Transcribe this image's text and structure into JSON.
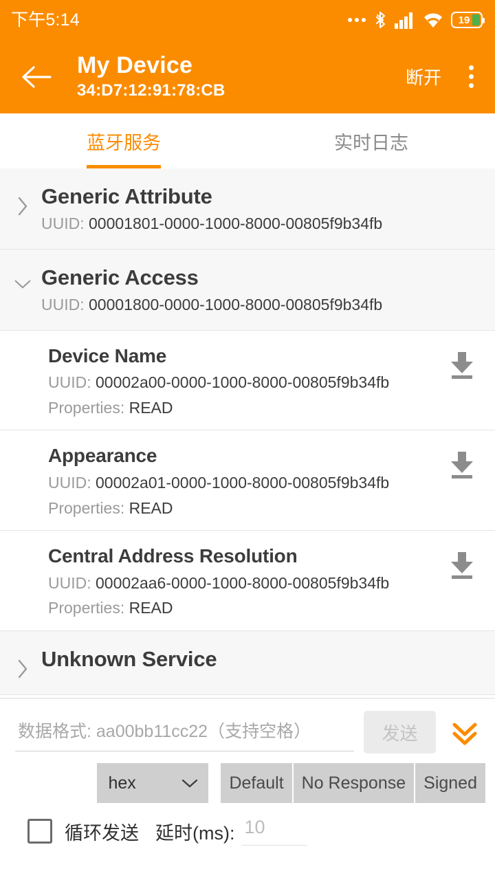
{
  "status_bar": {
    "time": "下午5:14",
    "icons": [
      "more-dots-icon",
      "bluetooth-icon",
      "cellular-signal-icon",
      "wifi-icon",
      "battery-icon"
    ],
    "battery_level": "19"
  },
  "app_bar": {
    "back_icon": "back-arrow-icon",
    "title": "My Device",
    "subtitle": "34:D7:12:91:78:CB",
    "action_label": "断开",
    "overflow_icon": "overflow-menu-icon",
    "background_color": "#fb8c00"
  },
  "tabs": {
    "active_index": 0,
    "items": [
      {
        "label": "蓝牙服务"
      },
      {
        "label": "实时日志"
      }
    ],
    "indicator_color": "#fb8c00"
  },
  "list": {
    "uuid_label": "UUID: ",
    "properties_label": "Properties: ",
    "services": [
      {
        "name": "Generic Attribute",
        "uuid": "00001801-0000-1000-8000-00805f9b34fb",
        "expanded": false,
        "chevron": "chevron-right-icon",
        "characteristics": []
      },
      {
        "name": "Generic Access",
        "uuid": "00001800-0000-1000-8000-00805f9b34fb",
        "expanded": true,
        "chevron": "chevron-down-icon",
        "characteristics": [
          {
            "name": "Device Name",
            "uuid": "00002a00-0000-1000-8000-00805f9b34fb",
            "properties": "READ",
            "action_icon": "download-read-icon"
          },
          {
            "name": "Appearance",
            "uuid": "00002a01-0000-1000-8000-00805f9b34fb",
            "properties": "READ",
            "action_icon": "download-read-icon"
          },
          {
            "name": "Central Address Resolution",
            "uuid": "00002aa6-0000-1000-8000-00805f9b34fb",
            "properties": "READ",
            "action_icon": "download-read-icon"
          }
        ]
      },
      {
        "name": "Unknown Service",
        "uuid": "",
        "expanded": false,
        "chevron": "chevron-right-icon",
        "characteristics": []
      }
    ]
  },
  "bottom_panel": {
    "data_input": {
      "value": "",
      "placeholder": "数据格式: aa00bb11cc22（支持空格）"
    },
    "send_button": "发送",
    "expand_icon": "double-chevron-down-icon",
    "expand_icon_color": "#fb8c00",
    "format_select": {
      "value": "hex",
      "chevron": "chevron-down-icon"
    },
    "write_modes": [
      {
        "label": "Default"
      },
      {
        "label": "No Response"
      },
      {
        "label": "Signed"
      }
    ],
    "loop_send": {
      "checked": false,
      "label": "循环发送"
    },
    "delay": {
      "label": "延时(ms):",
      "value": "",
      "placeholder": "10"
    }
  }
}
